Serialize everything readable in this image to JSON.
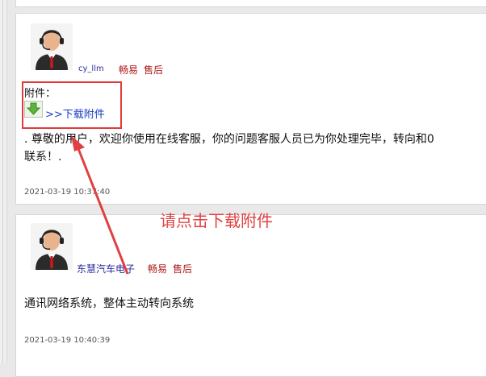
{
  "posts": [
    {
      "username": "cy_llm",
      "company": "畅易",
      "role": "售后",
      "attachment_label": "附件：",
      "download_link": ">>下载附件",
      "message": [
        ". 尊敬的用户，欢迎你使用在线客服，你的问题客服人员已为你处理完毕，转向和0",
        "联系！."
      ],
      "timestamp": "2021-03-19 10:37:40"
    },
    {
      "username": "东慧汽车电子",
      "company": "畅易",
      "role": "售后",
      "message": [
        "通讯网络系统，整体主动转向系统"
      ],
      "timestamp": "2021-03-19 10:40:39"
    }
  ],
  "annotation": {
    "text": "请点击下载附件",
    "color": "#e04040"
  },
  "colors": {
    "username": "#2a2a9e",
    "company": "#b01818",
    "link": "#1a3cc8"
  }
}
